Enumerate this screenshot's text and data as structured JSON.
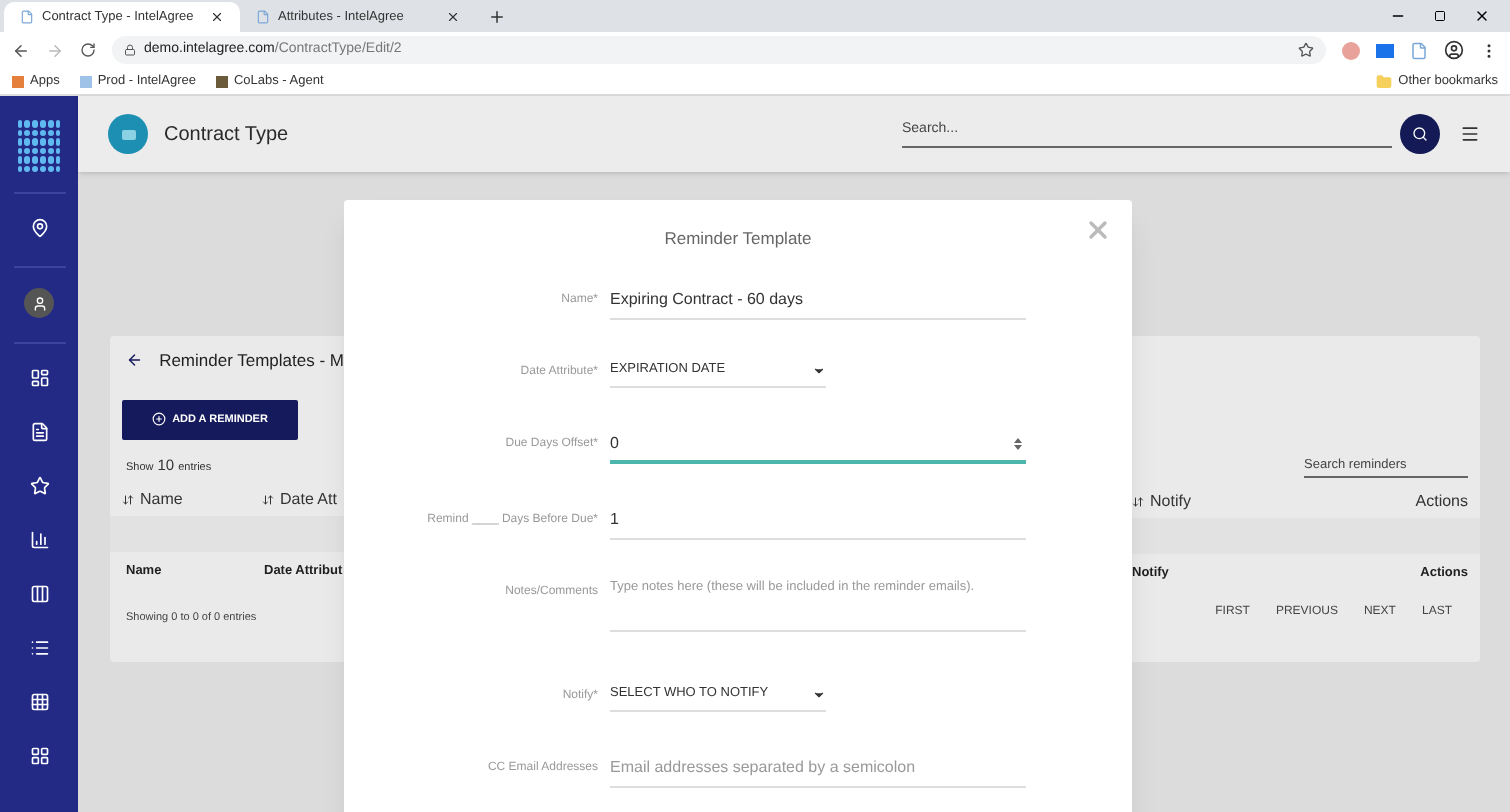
{
  "browser": {
    "tabs": [
      {
        "title": "Contract Type - IntelAgree",
        "selected": true
      },
      {
        "title": "Attributes - IntelAgree",
        "selected": false
      }
    ],
    "url_host": "demo.intelagree.com",
    "url_path": "/ContractType/Edit/2",
    "bookmarks": [
      "Apps",
      "Prod - IntelAgree",
      "CoLabs - Agent"
    ],
    "other_bookmarks": "Other bookmarks"
  },
  "header": {
    "title": "Contract Type",
    "search_placeholder": "Search..."
  },
  "card": {
    "title": "Reminder Templates - M",
    "add_button": "ADD A REMINDER",
    "show": "Show",
    "page_size": "10",
    "entries": "entries",
    "search_placeholder": "Search reminders",
    "columns_left": [
      "Name",
      "Date Att"
    ],
    "columns_right": [
      "Notify",
      "Actions"
    ],
    "footer_left": [
      "Name",
      "Date Attribut"
    ],
    "footer_right": [
      "Notify",
      "Actions"
    ],
    "info": "Showing 0 to 0 of 0 entries",
    "pagination": [
      "FIRST",
      "PREVIOUS",
      "NEXT",
      "LAST"
    ]
  },
  "modal": {
    "title": "Reminder Template",
    "fields": [
      {
        "kind": "text",
        "label": "Name*",
        "value": "Expiring Contract - 60 days",
        "focused": false
      },
      {
        "kind": "select",
        "label": "Date Attribute*",
        "value": "EXPIRATION DATE",
        "focused": false
      },
      {
        "kind": "number",
        "label": "Due Days Offset*",
        "value": "0",
        "focused": true
      },
      {
        "kind": "text",
        "label": "Remind ____ Days Before Due*",
        "value": "1",
        "focused": false
      },
      {
        "kind": "textarea",
        "label": "Notes/Comments",
        "placeholder": "Type notes here (these will be included in the reminder emails).",
        "focused": false
      },
      {
        "kind": "select",
        "label": "Notify*",
        "value": "SELECT WHO TO NOTIFY",
        "focused": false
      },
      {
        "kind": "text",
        "label": "CC Email Addresses",
        "placeholder": "Email addresses separated by a semicolon",
        "focused": false
      }
    ]
  }
}
